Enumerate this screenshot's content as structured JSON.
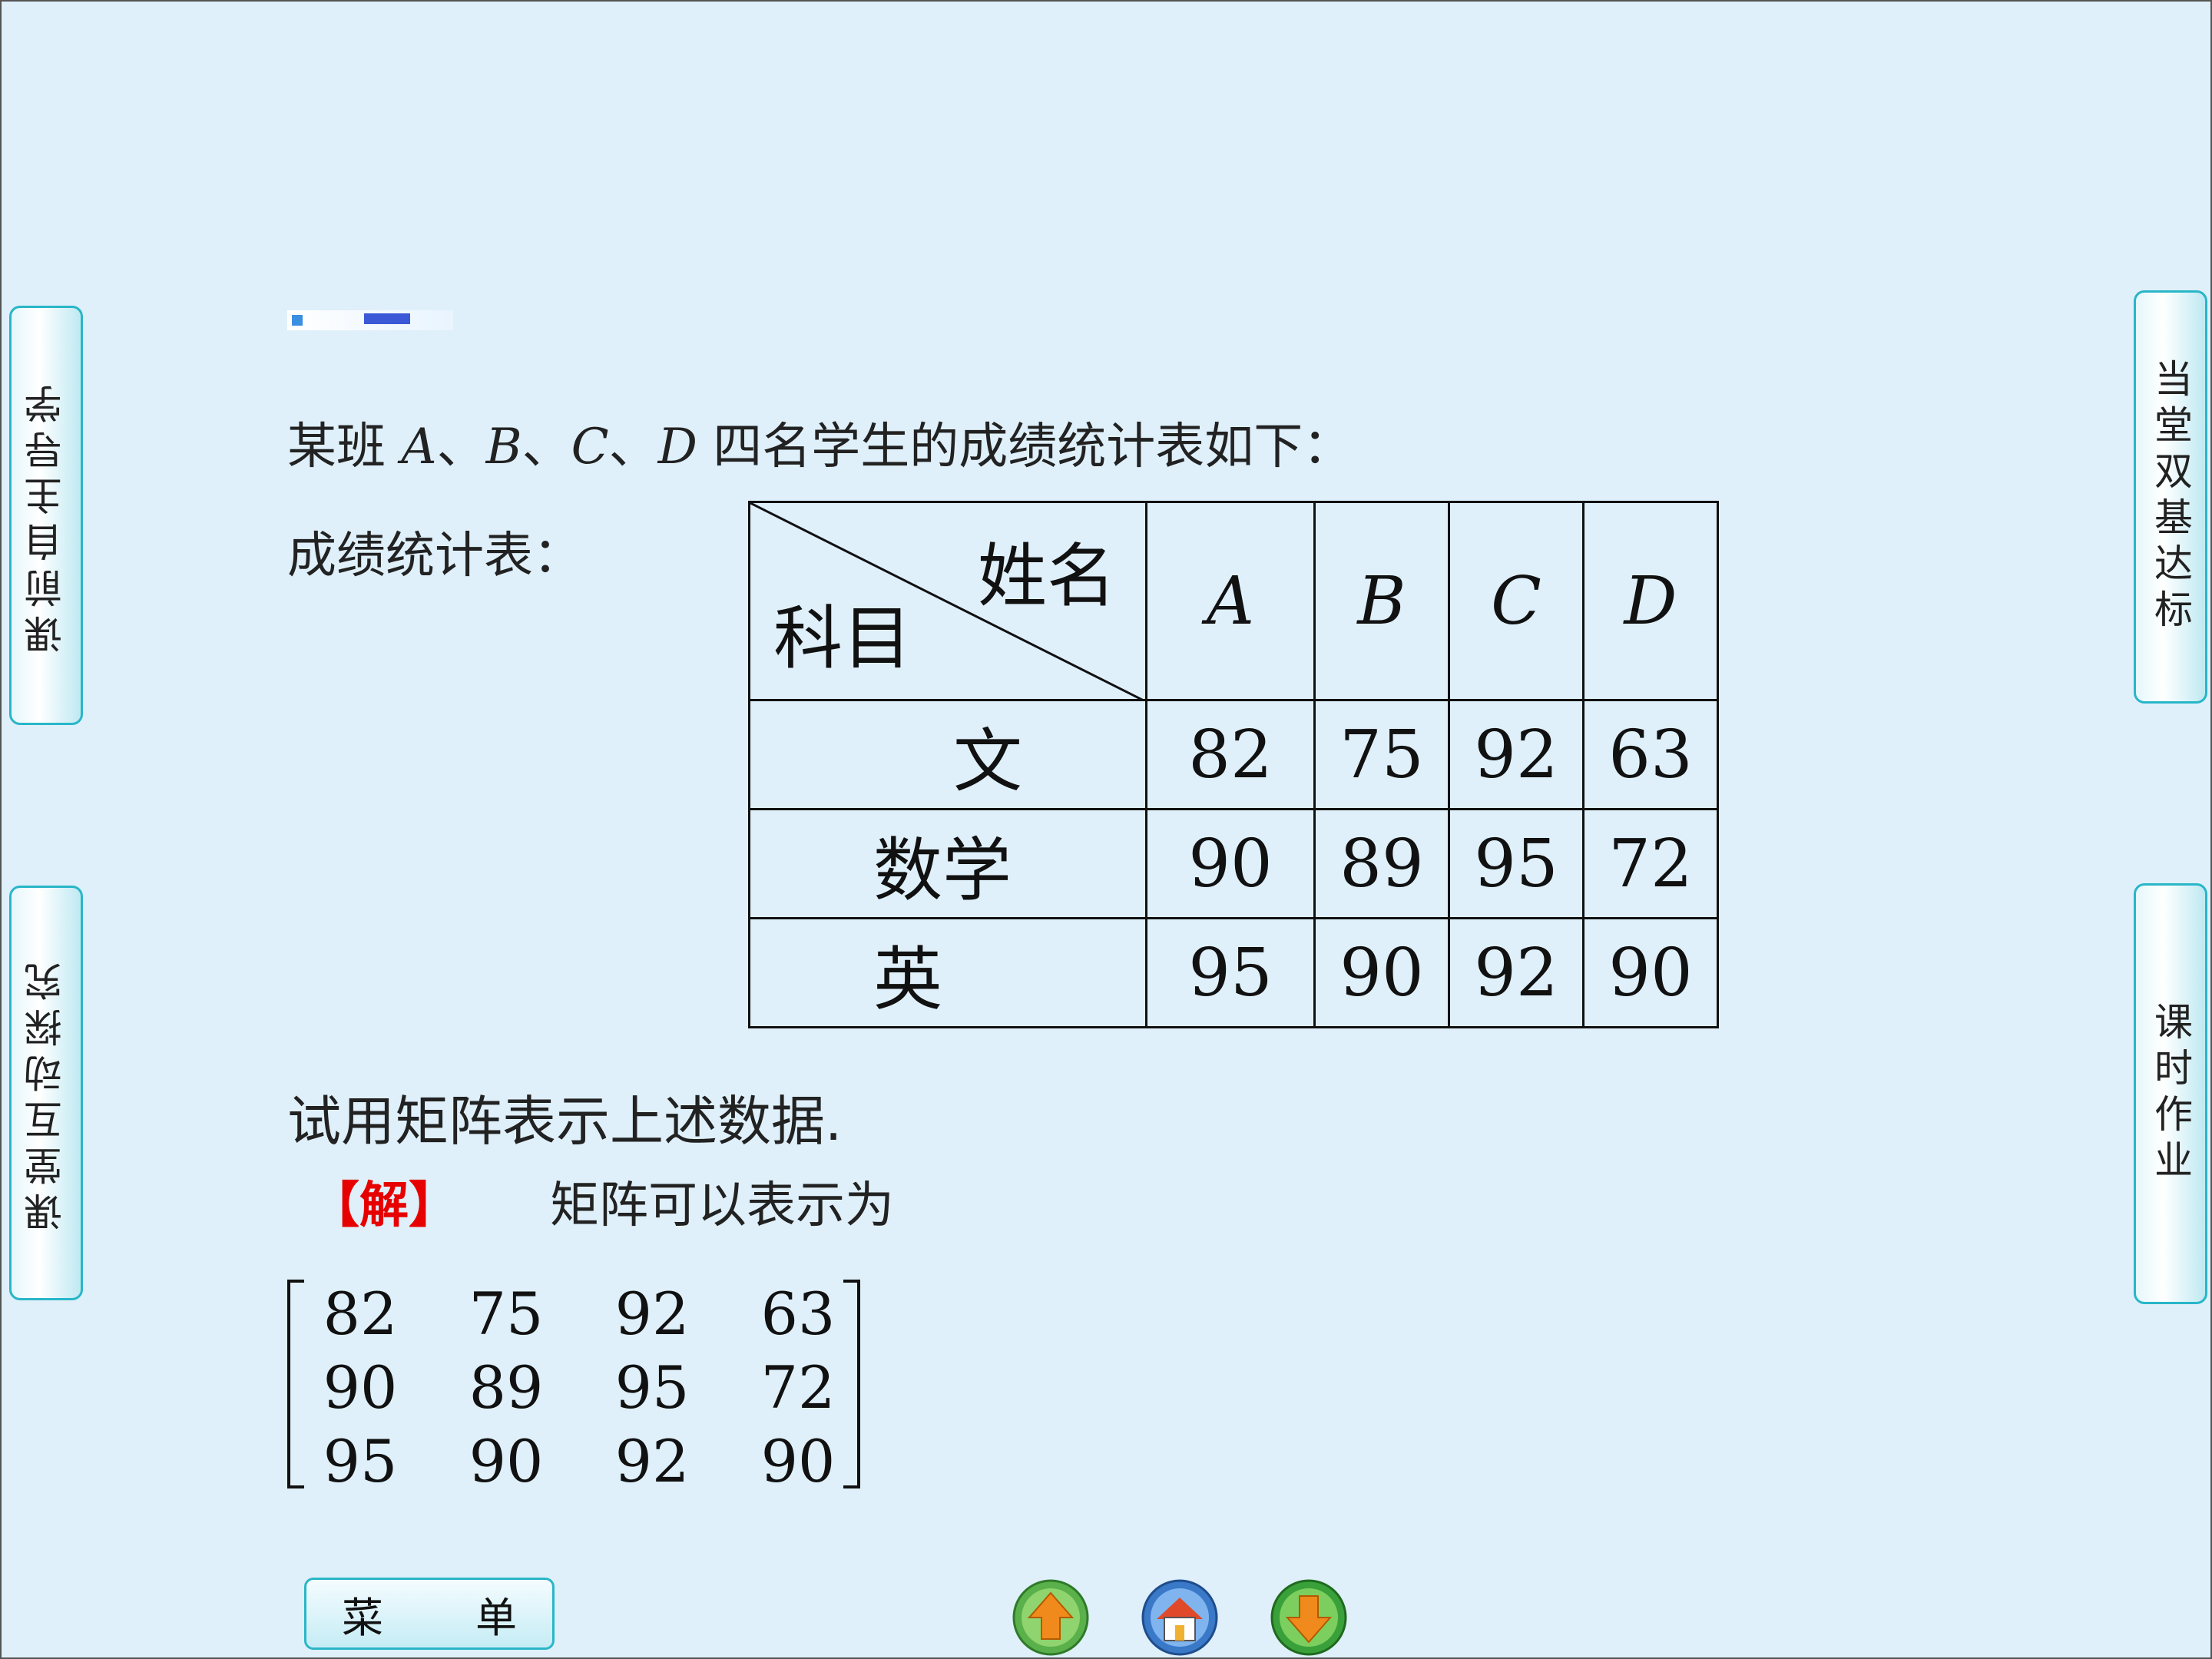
{
  "side_tabs": {
    "left_top": "课前自主导学",
    "left_bottom": "课堂互动探究",
    "right_top": "当堂双基达标",
    "right_bottom": "课时作业"
  },
  "problem": {
    "intro_prefix": "某班 ",
    "students": [
      "A",
      "B",
      "C",
      "D"
    ],
    "separator": "、",
    "intro_suffix": " 四名学生的成绩统计表如下：",
    "table_caption": "成绩统计表：",
    "header_name": "姓名",
    "header_subject": "科目",
    "table": {
      "columns": [
        "A",
        "B",
        "C",
        "D"
      ],
      "rows": [
        {
          "subject": "文",
          "scores": [
            "82",
            "75",
            "92",
            "63"
          ]
        },
        {
          "subject": "数学",
          "scores": [
            "90",
            "89",
            "95",
            "72"
          ]
        },
        {
          "subject": "英",
          "scores": [
            "95",
            "90",
            "92",
            "90"
          ]
        }
      ]
    },
    "question": "试用矩阵表示上述数据.",
    "solution_tag": "【解】",
    "solution_text": "矩阵可以表示为",
    "matrix": [
      [
        "82",
        "75",
        "92",
        "63"
      ],
      [
        "90",
        "89",
        "95",
        "72"
      ],
      [
        "95",
        "90",
        "92",
        "90"
      ]
    ]
  },
  "bottom_nav": {
    "menu_label": "菜单",
    "icons": [
      "up-arrow-icon",
      "home-icon",
      "down-arrow-icon"
    ]
  },
  "colors": {
    "background": "#dff0fa",
    "tab_border": "#29b6c8",
    "solution_red": "#e60000",
    "nav_orange": "#f08a1c",
    "nav_blue": "#3a78c8",
    "nav_green": "#3aa13a"
  }
}
